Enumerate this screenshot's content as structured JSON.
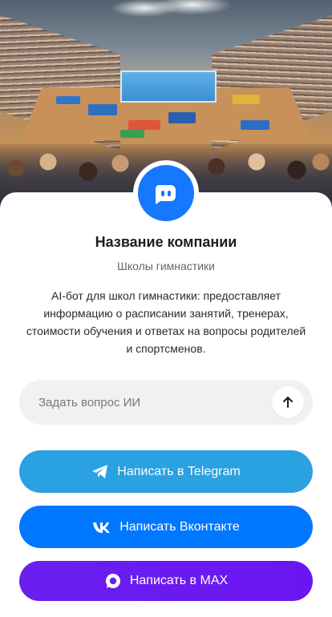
{
  "company": {
    "name": "Название компании",
    "category": "Школы гимнастики",
    "description": "AI-бот для школ гимнастики: предоставляет информацию о расписании занятий, тренерах, стоимости обучения и ответах на вопросы родителей и спортсменов."
  },
  "ask": {
    "placeholder": "Задать вопрос ИИ",
    "value": ""
  },
  "buttons": {
    "telegram": "Написать в Telegram",
    "vk": "Написать Вконтакте",
    "max": "Написать в MAX"
  },
  "icons": {
    "avatar": "chat-bot-icon",
    "send": "arrow-up-icon",
    "telegram": "telegram-icon",
    "vk": "vk-icon",
    "max": "max-icon"
  },
  "colors": {
    "avatar": "#1677ff",
    "telegram": "#2aa1e0",
    "vk": "#0077ff",
    "max": "#6a1ff0",
    "input_bg": "#f1f1f3"
  }
}
